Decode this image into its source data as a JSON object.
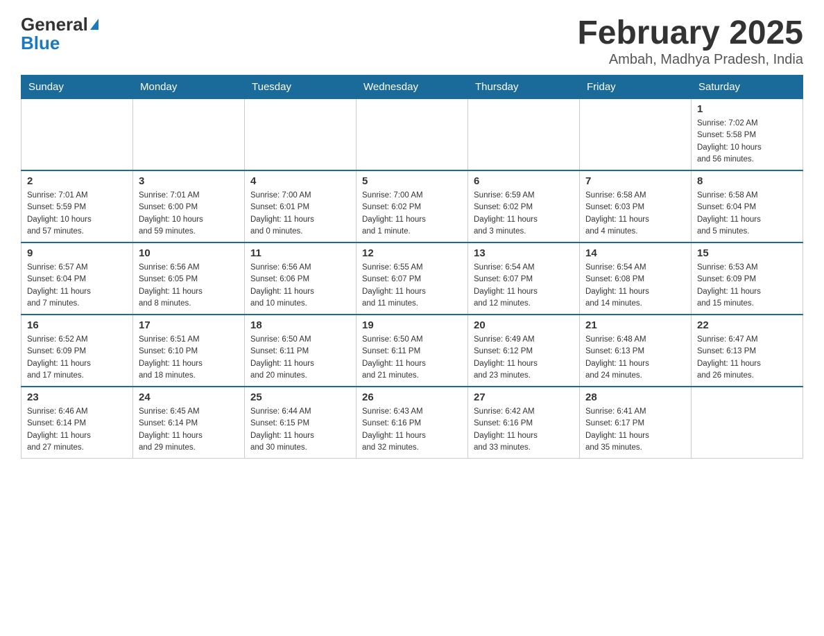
{
  "header": {
    "logo_general": "General",
    "logo_blue": "Blue",
    "month_title": "February 2025",
    "location": "Ambah, Madhya Pradesh, India"
  },
  "weekdays": [
    "Sunday",
    "Monday",
    "Tuesday",
    "Wednesday",
    "Thursday",
    "Friday",
    "Saturday"
  ],
  "weeks": [
    [
      {
        "day": "",
        "info": ""
      },
      {
        "day": "",
        "info": ""
      },
      {
        "day": "",
        "info": ""
      },
      {
        "day": "",
        "info": ""
      },
      {
        "day": "",
        "info": ""
      },
      {
        "day": "",
        "info": ""
      },
      {
        "day": "1",
        "info": "Sunrise: 7:02 AM\nSunset: 5:58 PM\nDaylight: 10 hours\nand 56 minutes."
      }
    ],
    [
      {
        "day": "2",
        "info": "Sunrise: 7:01 AM\nSunset: 5:59 PM\nDaylight: 10 hours\nand 57 minutes."
      },
      {
        "day": "3",
        "info": "Sunrise: 7:01 AM\nSunset: 6:00 PM\nDaylight: 10 hours\nand 59 minutes."
      },
      {
        "day": "4",
        "info": "Sunrise: 7:00 AM\nSunset: 6:01 PM\nDaylight: 11 hours\nand 0 minutes."
      },
      {
        "day": "5",
        "info": "Sunrise: 7:00 AM\nSunset: 6:02 PM\nDaylight: 11 hours\nand 1 minute."
      },
      {
        "day": "6",
        "info": "Sunrise: 6:59 AM\nSunset: 6:02 PM\nDaylight: 11 hours\nand 3 minutes."
      },
      {
        "day": "7",
        "info": "Sunrise: 6:58 AM\nSunset: 6:03 PM\nDaylight: 11 hours\nand 4 minutes."
      },
      {
        "day": "8",
        "info": "Sunrise: 6:58 AM\nSunset: 6:04 PM\nDaylight: 11 hours\nand 5 minutes."
      }
    ],
    [
      {
        "day": "9",
        "info": "Sunrise: 6:57 AM\nSunset: 6:04 PM\nDaylight: 11 hours\nand 7 minutes."
      },
      {
        "day": "10",
        "info": "Sunrise: 6:56 AM\nSunset: 6:05 PM\nDaylight: 11 hours\nand 8 minutes."
      },
      {
        "day": "11",
        "info": "Sunrise: 6:56 AM\nSunset: 6:06 PM\nDaylight: 11 hours\nand 10 minutes."
      },
      {
        "day": "12",
        "info": "Sunrise: 6:55 AM\nSunset: 6:07 PM\nDaylight: 11 hours\nand 11 minutes."
      },
      {
        "day": "13",
        "info": "Sunrise: 6:54 AM\nSunset: 6:07 PM\nDaylight: 11 hours\nand 12 minutes."
      },
      {
        "day": "14",
        "info": "Sunrise: 6:54 AM\nSunset: 6:08 PM\nDaylight: 11 hours\nand 14 minutes."
      },
      {
        "day": "15",
        "info": "Sunrise: 6:53 AM\nSunset: 6:09 PM\nDaylight: 11 hours\nand 15 minutes."
      }
    ],
    [
      {
        "day": "16",
        "info": "Sunrise: 6:52 AM\nSunset: 6:09 PM\nDaylight: 11 hours\nand 17 minutes."
      },
      {
        "day": "17",
        "info": "Sunrise: 6:51 AM\nSunset: 6:10 PM\nDaylight: 11 hours\nand 18 minutes."
      },
      {
        "day": "18",
        "info": "Sunrise: 6:50 AM\nSunset: 6:11 PM\nDaylight: 11 hours\nand 20 minutes."
      },
      {
        "day": "19",
        "info": "Sunrise: 6:50 AM\nSunset: 6:11 PM\nDaylight: 11 hours\nand 21 minutes."
      },
      {
        "day": "20",
        "info": "Sunrise: 6:49 AM\nSunset: 6:12 PM\nDaylight: 11 hours\nand 23 minutes."
      },
      {
        "day": "21",
        "info": "Sunrise: 6:48 AM\nSunset: 6:13 PM\nDaylight: 11 hours\nand 24 minutes."
      },
      {
        "day": "22",
        "info": "Sunrise: 6:47 AM\nSunset: 6:13 PM\nDaylight: 11 hours\nand 26 minutes."
      }
    ],
    [
      {
        "day": "23",
        "info": "Sunrise: 6:46 AM\nSunset: 6:14 PM\nDaylight: 11 hours\nand 27 minutes."
      },
      {
        "day": "24",
        "info": "Sunrise: 6:45 AM\nSunset: 6:14 PM\nDaylight: 11 hours\nand 29 minutes."
      },
      {
        "day": "25",
        "info": "Sunrise: 6:44 AM\nSunset: 6:15 PM\nDaylight: 11 hours\nand 30 minutes."
      },
      {
        "day": "26",
        "info": "Sunrise: 6:43 AM\nSunset: 6:16 PM\nDaylight: 11 hours\nand 32 minutes."
      },
      {
        "day": "27",
        "info": "Sunrise: 6:42 AM\nSunset: 6:16 PM\nDaylight: 11 hours\nand 33 minutes."
      },
      {
        "day": "28",
        "info": "Sunrise: 6:41 AM\nSunset: 6:17 PM\nDaylight: 11 hours\nand 35 minutes."
      },
      {
        "day": "",
        "info": ""
      }
    ]
  ]
}
